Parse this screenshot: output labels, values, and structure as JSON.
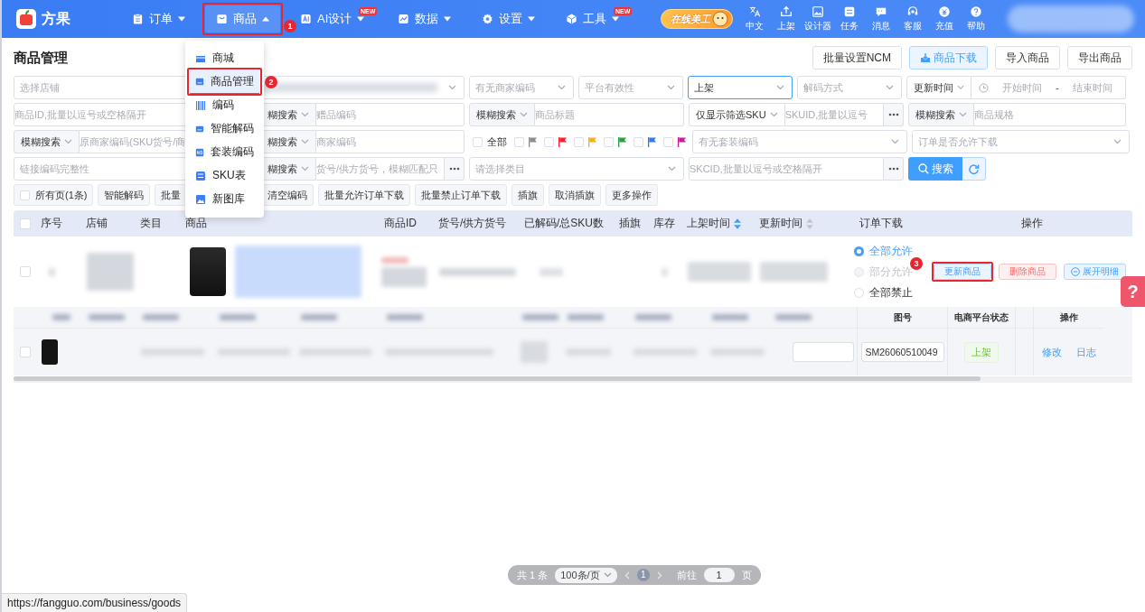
{
  "nav": {
    "brand": "方果",
    "items": [
      {
        "label": "订单",
        "selected": false,
        "expanded": false
      },
      {
        "label": "商品",
        "selected": true,
        "expanded": true,
        "annotation": "1"
      },
      {
        "label": "AI设计",
        "selected": false,
        "expanded": false,
        "badge": "NEW"
      },
      {
        "label": "数据",
        "selected": false,
        "expanded": false
      },
      {
        "label": "设置",
        "selected": false,
        "expanded": false
      },
      {
        "label": "工具",
        "selected": false,
        "expanded": false,
        "badge": "NEW"
      }
    ],
    "promo": "在线美工",
    "tools": [
      "中文",
      "上架",
      "设计器",
      "任务",
      "消息",
      "客服",
      "充值",
      "帮助"
    ]
  },
  "menu": {
    "items": [
      {
        "label": "商城",
        "selected": false
      },
      {
        "label": "商品管理",
        "selected": true,
        "annotation": "2"
      },
      {
        "label": "编码",
        "selected": false
      },
      {
        "label": "智能解码",
        "selected": false
      },
      {
        "label": "套装编码",
        "selected": false
      },
      {
        "label": "SKU表",
        "selected": false
      },
      {
        "label": "新图库",
        "selected": false
      }
    ]
  },
  "page": {
    "title": "商品管理",
    "actions": [
      {
        "label": "批量设置NCM",
        "kind": "plain"
      },
      {
        "label": "商品下载",
        "kind": "primary"
      },
      {
        "label": "导入商品",
        "kind": "plain"
      },
      {
        "label": "导出商品",
        "kind": "plain"
      }
    ]
  },
  "filters": {
    "rows": [
      {
        "fields": [
          {
            "kind": "select",
            "placeholder": "选择店铺",
            "focused": false
          },
          {
            "kind": "blurred-select"
          },
          {
            "kind": "select",
            "placeholder": "有无商家编码",
            "focused": false
          },
          {
            "kind": "select",
            "placeholder": "平台有效性",
            "focused": false
          },
          {
            "kind": "select",
            "value": "上架",
            "focused": true
          },
          {
            "kind": "select",
            "placeholder": "解码方式",
            "focused": false
          },
          {
            "kind": "daterange",
            "field": "更新时间",
            "start_placeholder": "开始时间",
            "separator": "-",
            "end_placeholder": "结束时间"
          }
        ]
      },
      {
        "fields": [
          {
            "kind": "input",
            "placeholder": "商品ID,批量以逗号或空格隔开",
            "more": false
          },
          {
            "kind": "input",
            "prefix": "糊搜索",
            "placeholder": "赠品编码",
            "more": false
          },
          {
            "kind": "input",
            "prefix": "模糊搜索",
            "placeholder": "商品标题",
            "more": false
          },
          {
            "kind": "select-input",
            "value": "仅显示筛选SKU",
            "placeholder": "SKUID,批量以逗号",
            "more": true
          },
          {
            "kind": "input",
            "prefix": "模糊搜索",
            "placeholder": "商品规格",
            "more": false
          }
        ]
      },
      {
        "fields": [
          {
            "kind": "input",
            "prefix": "模糊搜索",
            "placeholder": "原商家编码(SKU货号/商",
            "more": false
          },
          {
            "kind": "input",
            "prefix": "糊搜索",
            "placeholder": "商家编码",
            "more": false
          },
          {
            "kind": "flags",
            "all": {
              "label": "全部",
              "checked": false
            },
            "flags": [
              {
                "color": "#8c8c8c",
                "checked": false
              },
              {
                "color": "#f5222d",
                "checked": false
              },
              {
                "color": "#faad14",
                "checked": false
              },
              {
                "color": "#27a243",
                "checked": false
              },
              {
                "color": "#2f7cf6",
                "checked": false
              },
              {
                "color": "#c41d9c",
                "checked": false
              }
            ]
          },
          {
            "kind": "select",
            "placeholder": "有无套装编码",
            "focused": false
          },
          {
            "kind": "select",
            "placeholder": "订单是否允许下载",
            "focused": false
          }
        ]
      },
      {
        "fields": [
          {
            "kind": "select",
            "placeholder": "链接编码完整性",
            "focused": false
          },
          {
            "kind": "input",
            "prefix": "糊搜索",
            "placeholder": "货号/供方货号，模糊匹配只",
            "more": true
          },
          {
            "kind": "select",
            "placeholder": "请选择类目",
            "focused": false
          },
          {
            "kind": "input",
            "placeholder": "SKCID,批量以逗号或空格隔开",
            "more": true
          },
          {
            "kind": "search",
            "label": "搜索"
          }
        ]
      }
    ]
  },
  "toolbar": {
    "select_all": {
      "label": "所有页(1条)",
      "checked": false
    },
    "buttons": [
      "智能解码",
      "批量",
      "清空编码",
      "批量允许订单下载",
      "批量禁止订单下载",
      "插旗",
      "取消插旗",
      "更多操作"
    ]
  },
  "table": {
    "select_all_checked": false,
    "columns": [
      {
        "label": "序号"
      },
      {
        "label": "店铺"
      },
      {
        "label": "类目"
      },
      {
        "label": "商品"
      },
      {
        "label": "商品ID"
      },
      {
        "label": "货号/供方货号"
      },
      {
        "label": "已解码/总SKU数"
      },
      {
        "label": "插旗"
      },
      {
        "label": "库存"
      },
      {
        "label": "上架时间",
        "sorted": true
      },
      {
        "label": "更新时间",
        "sorted": false
      },
      {
        "label": "订单下载"
      },
      {
        "label": "操作"
      }
    ],
    "rows": [
      {
        "checked": false,
        "order_download": [
          {
            "label": "全部允许",
            "selected": true,
            "disabled": false
          },
          {
            "label": "部分允许",
            "selected": false,
            "disabled": true
          },
          {
            "label": "全部禁止",
            "selected": false,
            "disabled": false
          }
        ],
        "actions": [
          {
            "label": "更新商品",
            "kind": "primary",
            "annotation": "3"
          },
          {
            "label": "删除商品",
            "kind": "danger"
          },
          {
            "label": "展开明细",
            "kind": "expand"
          }
        ]
      }
    ]
  },
  "sku_table": {
    "columns": [
      {
        "label": "图号"
      },
      {
        "label": "电商平台状态"
      },
      {
        "label": "操作"
      }
    ],
    "rows": [
      {
        "checked": false,
        "figure_no": "SM26060510049",
        "status": "上架",
        "links": [
          "修改",
          "日志"
        ]
      }
    ]
  },
  "pager": {
    "total": "共 1 条",
    "page_size": "100条/页",
    "pages": [
      {
        "label": "1",
        "selected": true
      }
    ],
    "goto_label": "前往",
    "goto_value": "1",
    "unit": "页"
  },
  "status_url": "https://fangguo.com/business/goods",
  "help_tab": "?"
}
